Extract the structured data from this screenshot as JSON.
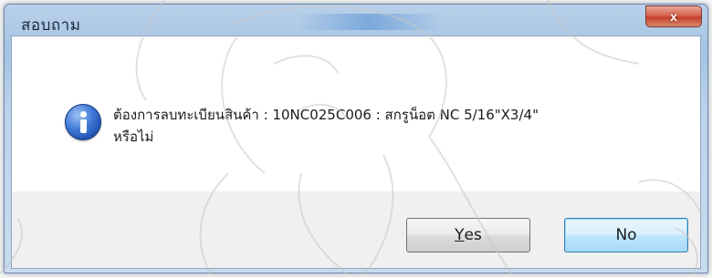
{
  "window": {
    "title": "สอบถาม",
    "close_label": "x"
  },
  "message": {
    "line1": "ต้องการลบทะเบียนสินค้า : 10NC025C006 : สกรูน็อต NC 5/16\"X3/4\"",
    "line2": "หรือไม่",
    "icon": "info-icon"
  },
  "buttons": {
    "yes_accel": "Y",
    "yes_rest": "es",
    "no_label": "No"
  }
}
